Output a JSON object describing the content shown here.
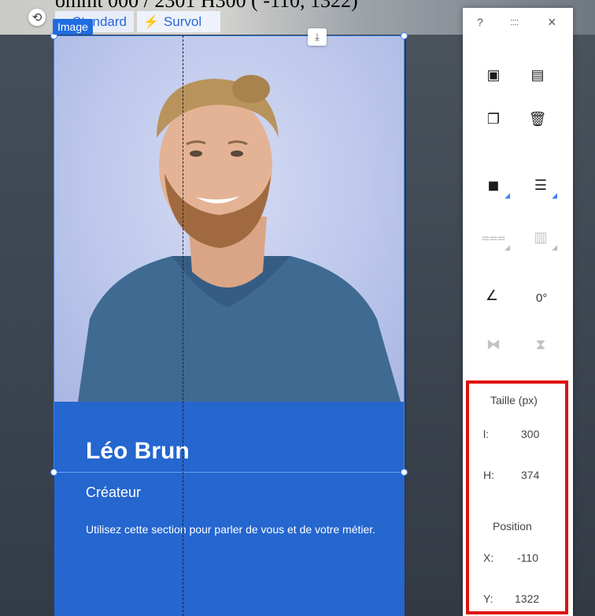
{
  "caption": "ommt 000 / 2301 H300 ( -110, 1322)",
  "modes": {
    "standard": "Standard",
    "hover": "Survol"
  },
  "element_tag": "Image",
  "card": {
    "name": "Léo Brun",
    "role": "Créateur",
    "description": "Utilisez cette section pour parler de vous et de votre métier."
  },
  "toolbar": {
    "help": "?",
    "grip": "::::",
    "close": "×",
    "rotation": "0°"
  },
  "size": {
    "title": "Taille (px)",
    "w_label": "l:",
    "w_value": "300",
    "h_label": "H:",
    "h_value": "374"
  },
  "position": {
    "title": "Position",
    "x_label": "X:",
    "x_value": "-110",
    "y_label": "Y:",
    "y_value": "1322"
  },
  "icons": [
    "rotate-icon",
    "lightning-icon",
    "download-icon",
    "copy-icon",
    "paste-icon",
    "duplicate-icon",
    "trash-icon",
    "arrange-icon",
    "align-icon",
    "distribute-icon",
    "match-size-icon",
    "angle-icon",
    "flip-horizontal-icon",
    "flip-vertical-icon"
  ],
  "colors": {
    "accent": "#2566cf",
    "selection": "#3a85f0",
    "highlight": "#e01010"
  }
}
